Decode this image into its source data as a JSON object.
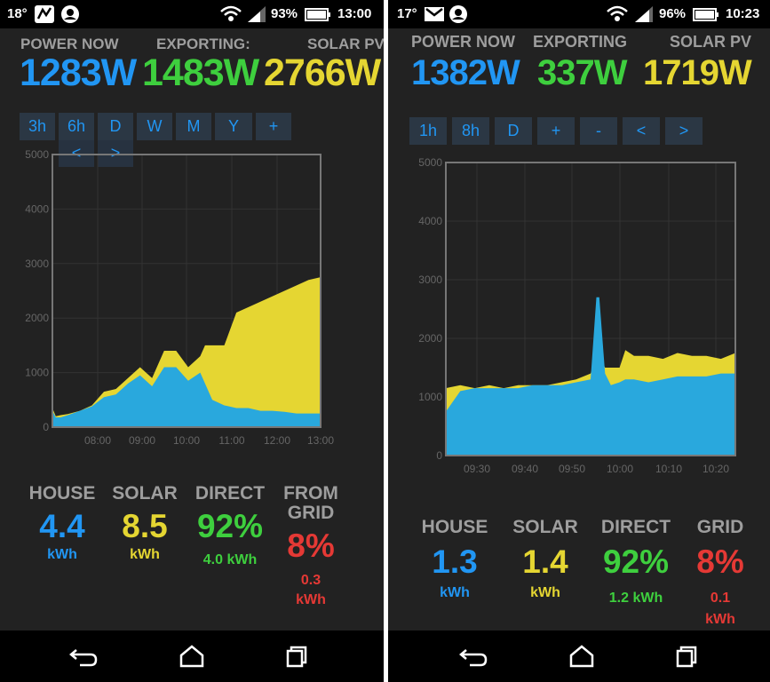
{
  "colors": {
    "house": "#2196f3",
    "exporting": "#3ecf3e",
    "solar": "#e5d632",
    "grid": "#e53935",
    "bg": "#222222"
  },
  "left": {
    "status": {
      "temp": "18°",
      "battery": "93%",
      "time": "13:00"
    },
    "header": {
      "power_label": "POWER NOW",
      "export_label": "EXPORTING:",
      "solar_label": "SOLAR PV",
      "power": "1283W",
      "export": "1483W",
      "solar": "2766W"
    },
    "buttons": [
      "3h",
      "6h",
      "D",
      "W",
      "M",
      "Y",
      "+",
      "<",
      ">"
    ],
    "chart_data": {
      "type": "area",
      "ylim": [
        0,
        5000
      ],
      "yticks": [
        "0",
        "1000",
        "2000",
        "3000",
        "4000",
        "5000"
      ],
      "xticks": [
        "08:00",
        "09:00",
        "10:00",
        "11:00",
        "12:00",
        "13:00"
      ],
      "series": [
        {
          "name": "Solar",
          "color": "#e5d632",
          "x": [
            7.43,
            7.5,
            7.6,
            7.75,
            8.0,
            8.25,
            8.5,
            8.75,
            9.0,
            9.25,
            9.5,
            9.75,
            10.0,
            10.25,
            10.5,
            10.6,
            11.0,
            11.25,
            11.5,
            11.75,
            12.0,
            12.25,
            12.5,
            12.75,
            13.0
          ],
          "y": [
            350,
            200,
            220,
            240,
            300,
            400,
            650,
            700,
            900,
            1100,
            900,
            1400,
            1400,
            1100,
            1300,
            1500,
            1500,
            2100,
            2200,
            2300,
            2400,
            2500,
            2600,
            2700,
            2750
          ]
        },
        {
          "name": "House",
          "color": "#29a8dd",
          "x": [
            7.43,
            7.5,
            7.6,
            7.75,
            8.0,
            8.25,
            8.5,
            8.75,
            9.0,
            9.25,
            9.5,
            9.75,
            10.0,
            10.25,
            10.5,
            10.75,
            11.0,
            11.25,
            11.5,
            11.75,
            12.0,
            12.25,
            12.5,
            12.75,
            13.0
          ],
          "y": [
            300,
            180,
            180,
            220,
            300,
            380,
            550,
            600,
            800,
            950,
            750,
            1100,
            1100,
            850,
            1000,
            500,
            400,
            350,
            350,
            300,
            300,
            280,
            250,
            250,
            250
          ]
        }
      ]
    },
    "stats": {
      "house": {
        "label": "HOUSE",
        "value": "4.4",
        "unit": "kWh"
      },
      "solar": {
        "label": "SOLAR",
        "value": "8.5",
        "unit": "kWh"
      },
      "direct": {
        "label": "DIRECT",
        "value": "92%",
        "sub": "4.0 kWh"
      },
      "grid": {
        "label1": "FROM",
        "label2": "GRID",
        "value": "8%",
        "sub1": "0.3",
        "sub2": "kWh"
      }
    }
  },
  "right": {
    "status": {
      "temp": "17°",
      "battery": "96%",
      "time": "10:23"
    },
    "header": {
      "power_label": "POWER NOW",
      "export_label": "EXPORTING",
      "solar_label": "SOLAR PV",
      "power": "1382W",
      "export": "337W",
      "solar": "1719W"
    },
    "buttons": [
      "1h",
      "8h",
      "D",
      "+",
      "-",
      "<",
      ">"
    ],
    "chart_data": {
      "type": "area",
      "ylim": [
        0,
        5000
      ],
      "yticks": [
        "0",
        "1000",
        "2000",
        "3000",
        "4000",
        "5000"
      ],
      "xticks": [
        "09:30",
        "09:40",
        "09:50",
        "10:00",
        "10:10",
        "10:20"
      ],
      "series": [
        {
          "name": "Solar",
          "color": "#e5d632",
          "x": [
            0,
            5,
            10,
            15,
            20,
            25,
            30,
            35,
            40,
            45,
            50,
            52,
            53,
            55,
            57,
            60,
            62,
            65,
            70,
            75,
            80,
            85,
            90,
            95,
            100
          ],
          "y": [
            1150,
            1200,
            1150,
            1200,
            1150,
            1200,
            1200,
            1200,
            1250,
            1300,
            1400,
            1700,
            1700,
            1500,
            1500,
            1500,
            1800,
            1700,
            1700,
            1650,
            1750,
            1700,
            1700,
            1650,
            1750
          ]
        },
        {
          "name": "House",
          "color": "#29a8dd",
          "x": [
            0,
            5,
            10,
            15,
            20,
            25,
            30,
            35,
            40,
            45,
            50,
            52,
            53,
            55,
            57,
            60,
            62,
            65,
            70,
            75,
            80,
            85,
            90,
            95,
            100
          ],
          "y": [
            750,
            1100,
            1150,
            1150,
            1150,
            1150,
            1200,
            1200,
            1200,
            1250,
            1300,
            2700,
            2700,
            1400,
            1200,
            1250,
            1300,
            1300,
            1250,
            1300,
            1350,
            1350,
            1350,
            1400,
            1400
          ]
        }
      ]
    },
    "stats": {
      "house": {
        "label": "HOUSE",
        "value": "1.3",
        "unit": "kWh"
      },
      "solar": {
        "label": "SOLAR",
        "value": "1.4",
        "unit": "kWh"
      },
      "direct": {
        "label": "DIRECT",
        "value": "92%",
        "sub": "1.2 kWh"
      },
      "grid": {
        "label": "GRID",
        "value": "8%",
        "sub1": "0.1",
        "sub2": "kWh"
      }
    }
  }
}
